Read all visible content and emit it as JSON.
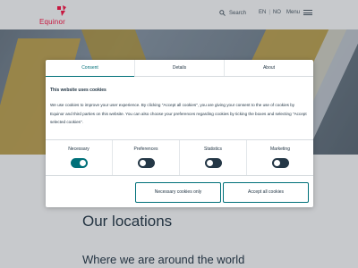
{
  "header": {
    "logo_text": "Equinor",
    "search_label": "Search",
    "lang_primary": "EN",
    "lang_separator": "|",
    "lang_secondary": "NO",
    "menu_label": "Menu"
  },
  "page": {
    "title": "Our locations",
    "subtitle": "Where we are around the world"
  },
  "consent": {
    "tabs": [
      {
        "label": "Consent",
        "active": true
      },
      {
        "label": "Details",
        "active": false
      },
      {
        "label": "About",
        "active": false
      }
    ],
    "heading": "This website uses cookies",
    "body": "We use cookies to improve your user experience. By clicking \"Accept all cookies\", you are giving your consent to the use of cookies by Equinor and third parties on this website. You can also choose your preferences regarding cookies by ticking the boxes and selecting \"Accept selected cookies\".",
    "toggles": [
      {
        "label": "Necessary",
        "on": true
      },
      {
        "label": "Preferences",
        "on": false
      },
      {
        "label": "Statistics",
        "on": false
      },
      {
        "label": "Marketing",
        "on": false
      }
    ],
    "buttons": {
      "necessary_only": "Necessary cookies only",
      "accept_all": "Accept all cookies"
    }
  },
  "colors": {
    "brand": "#ff1243",
    "accent": "#007079",
    "text": "#243746"
  }
}
